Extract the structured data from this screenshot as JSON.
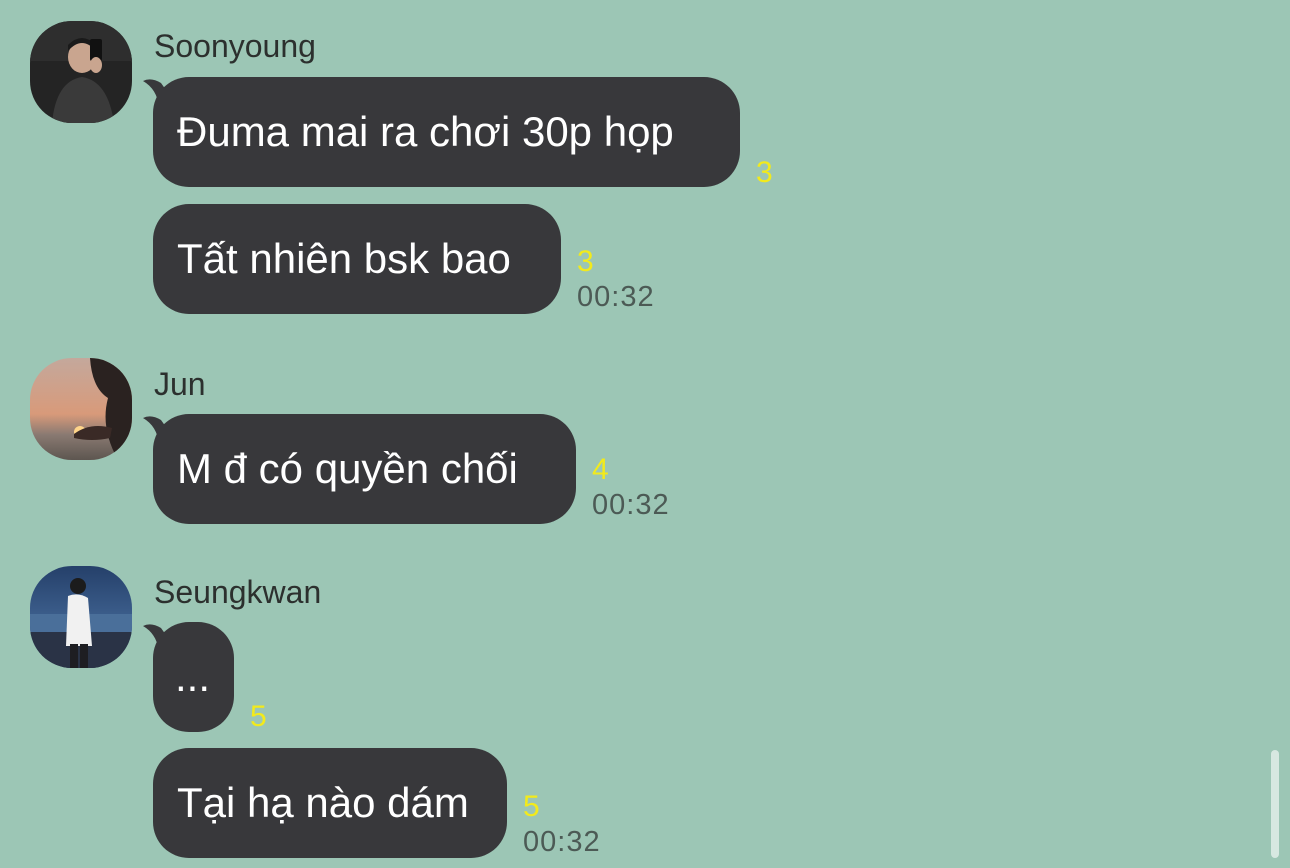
{
  "theme": {
    "background": "#9cc6b5",
    "bubble": "#38383b",
    "read_count_color": "#f2ea1c"
  },
  "groups": [
    {
      "sender": "Soonyoung",
      "messages": [
        {
          "text": "Đuma mai ra chơi 30p họp",
          "read_count": "3",
          "time": ""
        },
        {
          "text": "Tất nhiên bsk bao",
          "read_count": "3",
          "time": "00:32"
        }
      ]
    },
    {
      "sender": "Jun",
      "messages": [
        {
          "text": "M đ có quyền chối",
          "read_count": "4",
          "time": "00:32"
        }
      ]
    },
    {
      "sender": "Seungkwan",
      "messages": [
        {
          "text": "...",
          "read_count": "5",
          "time": ""
        },
        {
          "text": "Tại hạ nào dám",
          "read_count": "5",
          "time": "00:32"
        }
      ]
    }
  ]
}
